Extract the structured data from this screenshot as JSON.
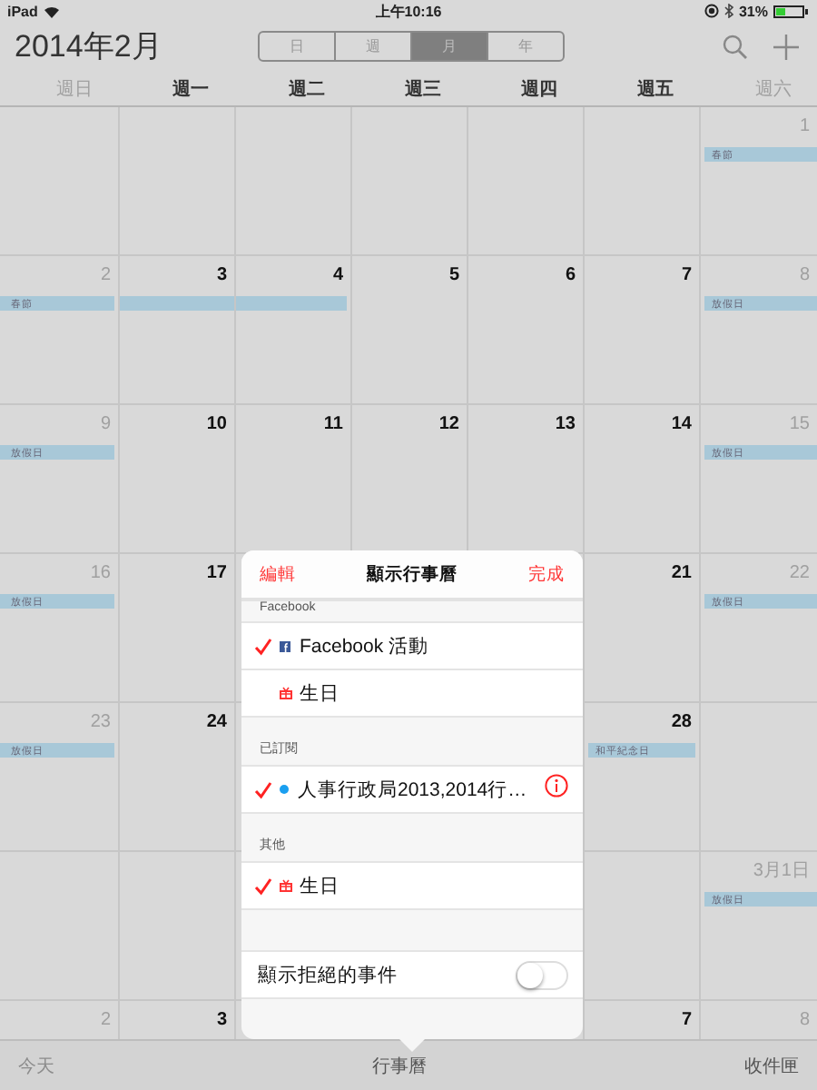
{
  "status_bar": {
    "device": "iPad",
    "time": "上午10:16",
    "battery": "31%"
  },
  "header": {
    "title": "2014年2月",
    "segments": [
      {
        "label": "日",
        "selected": false
      },
      {
        "label": "週",
        "selected": false
      },
      {
        "label": "月",
        "selected": true
      },
      {
        "label": "年",
        "selected": false
      }
    ]
  },
  "weekdays": [
    {
      "label": "週日",
      "weekend": true
    },
    {
      "label": "週一",
      "weekend": false
    },
    {
      "label": "週二",
      "weekend": false
    },
    {
      "label": "週三",
      "weekend": false
    },
    {
      "label": "週四",
      "weekend": false
    },
    {
      "label": "週五",
      "weekend": false
    },
    {
      "label": "週六",
      "weekend": true
    }
  ],
  "weeks": [
    {
      "cells": [
        {},
        {},
        {},
        {},
        {},
        {},
        {
          "day": "1",
          "weekend": true,
          "events": [
            {
              "kind": "start",
              "title": "春節"
            }
          ]
        }
      ]
    },
    {
      "cells": [
        {
          "day": "2",
          "weekend": true,
          "events": [
            {
              "kind": "start",
              "title": "春節"
            }
          ]
        },
        {
          "day": "3",
          "weekend": false,
          "events": [
            {
              "kind": "continuation"
            }
          ]
        },
        {
          "day": "4",
          "weekend": false,
          "events": [
            {
              "kind": "end"
            }
          ]
        },
        {
          "day": "5",
          "weekend": false
        },
        {
          "day": "6",
          "weekend": false
        },
        {
          "day": "7",
          "weekend": false
        },
        {
          "day": "8",
          "weekend": true,
          "events": [
            {
              "kind": "start",
              "title": "放假日"
            }
          ]
        }
      ]
    },
    {
      "cells": [
        {
          "day": "9",
          "weekend": true,
          "events": [
            {
              "kind": "start",
              "title": "放假日"
            }
          ]
        },
        {
          "day": "10",
          "weekend": false
        },
        {
          "day": "11",
          "weekend": false
        },
        {
          "day": "12",
          "weekend": false
        },
        {
          "day": "13",
          "weekend": false
        },
        {
          "day": "14",
          "weekend": false
        },
        {
          "day": "15",
          "weekend": true,
          "events": [
            {
              "kind": "start",
              "title": "放假日"
            }
          ]
        }
      ]
    },
    {
      "cells": [
        {
          "day": "16",
          "weekend": true,
          "events": [
            {
              "kind": "start",
              "title": "放假日"
            }
          ]
        },
        {
          "day": "17",
          "weekend": false
        },
        {},
        {},
        {},
        {
          "day": "21",
          "weekend": false
        },
        {
          "day": "22",
          "weekend": true,
          "events": [
            {
              "kind": "start",
              "title": "放假日"
            }
          ]
        }
      ]
    },
    {
      "cells": [
        {
          "day": "23",
          "weekend": true,
          "events": [
            {
              "kind": "start",
              "title": "放假日"
            }
          ]
        },
        {
          "day": "24",
          "weekend": false
        },
        {},
        {},
        {},
        {
          "day": "28",
          "weekend": false,
          "events": [
            {
              "kind": "start",
              "title": "和平紀念日"
            }
          ]
        },
        {}
      ]
    },
    {
      "cells": [
        {},
        {},
        {},
        {},
        {},
        {},
        {
          "day": "3月1日",
          "weekend": true,
          "events": [
            {
              "kind": "start",
              "title": "放假日"
            }
          ]
        }
      ]
    },
    {
      "cells": [
        {
          "day": "2",
          "weekend": true
        },
        {
          "day": "3",
          "weekend": false
        },
        {},
        {},
        {},
        {
          "day": "7",
          "weekend": false
        },
        {
          "day": "8",
          "weekend": true
        }
      ]
    }
  ],
  "popover": {
    "edit": "編輯",
    "title": "顯示行事曆",
    "done": "完成",
    "sections": [
      {
        "header": "Facebook",
        "rows": [
          {
            "label": "Facebook 活動",
            "kind": "facebook",
            "checked": true
          },
          {
            "label": "生日",
            "kind": "birthday",
            "checked": false
          }
        ]
      },
      {
        "header": "已訂閱",
        "rows": [
          {
            "label": "人事行政局2013,2014行…",
            "kind": "subscribed",
            "color": "#1a9ff0",
            "checked": true,
            "info": true
          }
        ]
      },
      {
        "header": "其他",
        "rows": [
          {
            "label": "生日",
            "kind": "birthday",
            "checked": true
          }
        ]
      }
    ],
    "toggle": {
      "label": "顯示拒絕的事件",
      "on": false
    }
  },
  "tab_bar": [
    {
      "label": "今天",
      "disabled": true
    },
    {
      "label": "行事曆",
      "disabled": false
    },
    {
      "label": "收件匣",
      "disabled": false
    }
  ]
}
